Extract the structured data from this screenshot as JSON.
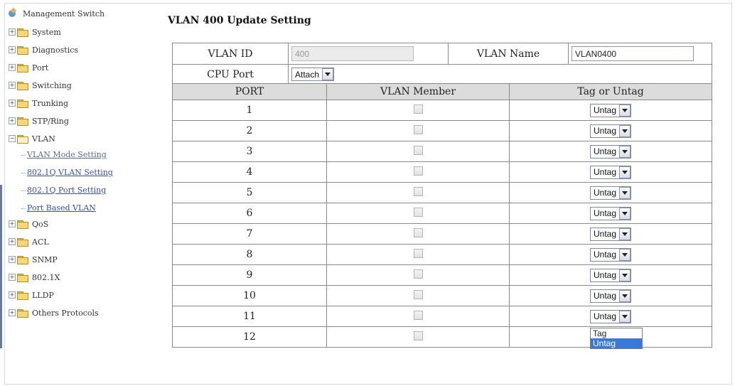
{
  "sidebar": {
    "root": "Management Switch",
    "items": [
      {
        "label": "System"
      },
      {
        "label": "Diagnostics"
      },
      {
        "label": "Port"
      },
      {
        "label": "Switching"
      },
      {
        "label": "Trunking"
      },
      {
        "label": "STP/Ring"
      },
      {
        "label": "VLAN"
      },
      {
        "label": "QoS"
      },
      {
        "label": "ACL"
      },
      {
        "label": "SNMP"
      },
      {
        "label": "802.1X"
      },
      {
        "label": "LLDP"
      },
      {
        "label": "Others Protocols"
      }
    ],
    "vlan_children": [
      {
        "label": "VLAN Mode Setting"
      },
      {
        "label": "802.1Q VLAN Setting"
      },
      {
        "label": "802.1Q Port Setting"
      },
      {
        "label": "Port Based VLAN"
      }
    ]
  },
  "page": {
    "title": "VLAN 400 Update Setting",
    "vlan_id_label": "VLAN ID",
    "vlan_id_value": "400",
    "vlan_name_label": "VLAN Name",
    "vlan_name_value": "VLAN0400",
    "cpu_port_label": "CPU Port",
    "cpu_port_value": "Attach"
  },
  "port_table": {
    "headers": [
      "PORT",
      "VLAN Member",
      "Tag or Untag"
    ],
    "rows": [
      {
        "port": "1",
        "tag": "Untag",
        "member": false
      },
      {
        "port": "2",
        "tag": "Untag",
        "member": false
      },
      {
        "port": "3",
        "tag": "Untag",
        "member": false
      },
      {
        "port": "4",
        "tag": "Untag",
        "member": false
      },
      {
        "port": "5",
        "tag": "Untag",
        "member": false
      },
      {
        "port": "6",
        "tag": "Untag",
        "member": false
      },
      {
        "port": "7",
        "tag": "Untag",
        "member": false
      },
      {
        "port": "8",
        "tag": "Untag",
        "member": false
      },
      {
        "port": "9",
        "tag": "Untag",
        "member": false
      },
      {
        "port": "10",
        "tag": "Untag",
        "member": false
      },
      {
        "port": "11",
        "tag": "Untag",
        "member": false
      },
      {
        "port": "12",
        "tag": "Untag",
        "member": false
      }
    ]
  },
  "dropdown_open": {
    "options": [
      "Tag",
      "Untag"
    ],
    "highlighted": "Untag"
  }
}
